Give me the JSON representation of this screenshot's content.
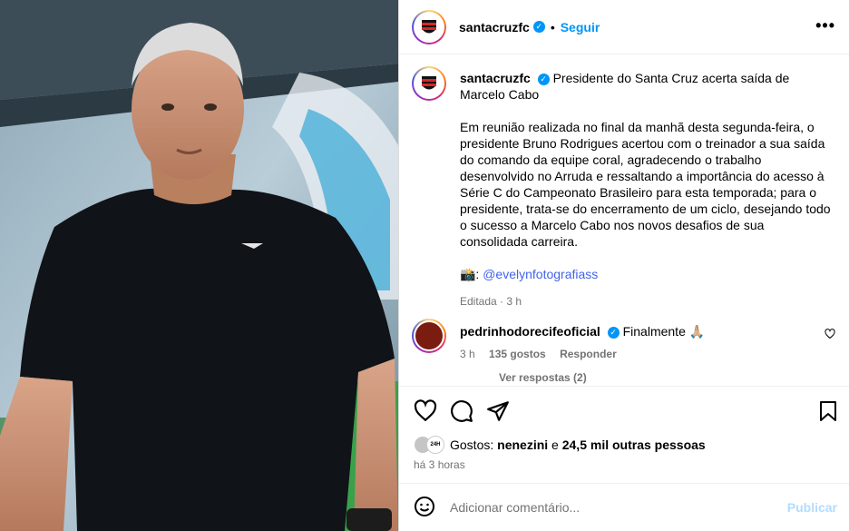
{
  "post": {
    "username": "santacruzfc",
    "follow_label": "Seguir",
    "more_label": "•••",
    "verified_mark": "✓",
    "dot": "•"
  },
  "caption": {
    "username": "santacruzfc",
    "headline": "Presidente do Santa Cruz acerta saída de Marcelo Cabo",
    "body": "Em reunião realizada no final da manhã desta segunda-feira, o presidente Bruno Rodrigues acertou com o treinador a sua saída do comando da equipe coral, agradecendo o trabalho desenvolvido no Arruda e ressaltando a importância do acesso à Série C do Campeonato Brasileiro para esta temporada; para o presidente, trata-se do encerramento de um ciclo, desejando todo o sucesso a Marcelo Cabo nos novos desafios de sua consolidada carreira.",
    "credit_prefix": "📸: ",
    "credit_mention": "@evelynfotografiass",
    "edited": "Editada · 3 h"
  },
  "comment": {
    "username": "pedrinhodorecifeoficial",
    "text": "Finalmente 🙏🏼",
    "time": "3 h",
    "likes": "135 gostos",
    "reply": "Responder",
    "view_replies": "Ver respostas (2)"
  },
  "likes": {
    "prefix": "Gostos: ",
    "user": "nenezini",
    "middle": " e ",
    "others": "24,5 mil outras pessoas",
    "badge": "24H"
  },
  "time_ago": "há 3 horas",
  "add_comment": {
    "placeholder": "Adicionar comentário...",
    "publish": "Publicar"
  },
  "icons": [
    "heart-icon",
    "comment-icon",
    "share-icon",
    "bookmark-icon",
    "emoji-icon"
  ],
  "colors": {
    "accent": "#0095f6",
    "muted": "#737373",
    "publish_disabled": "#b3dbff"
  }
}
